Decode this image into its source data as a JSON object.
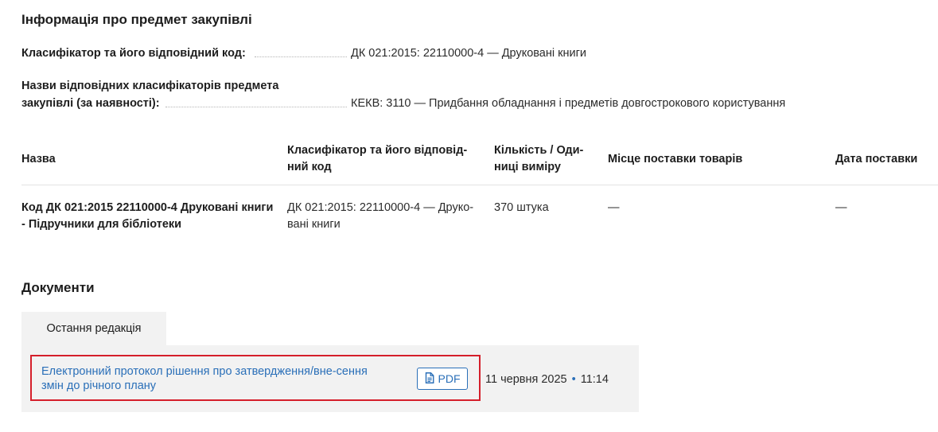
{
  "info": {
    "title": "Інформація про предмет закупівлі",
    "classifier_label": "Класифікатор та його відповідний код:",
    "classifier_value": "ДК 021:2015: 22110000-4 — Друковані книги",
    "related_label_line1": "Назви відповідних класифікаторів предмета",
    "related_label_line2": "закупівлі (за наявності):",
    "related_value": "КЕКВ: 3110 — Придбання обладнання і предметів довгострокового користування"
  },
  "items_table": {
    "headers": {
      "name": "Назва",
      "classifier": "Класифікатор та його відповід-ний код",
      "quantity": "Кількість / Оди-ниці виміру",
      "place": "Місце поставки товарів",
      "date": "Дата поставки"
    },
    "rows": [
      {
        "name": "Код ДК 021:2015 22110000-4 Друковані книги - Підручники для бібліотеки",
        "classifier": "ДК 021:2015: 22110000-4 — Друко-вані книги",
        "quantity": "370 штука",
        "place": "—",
        "date": "—"
      }
    ]
  },
  "documents": {
    "title": "Документи",
    "tab_label": "Остання редакція",
    "items": [
      {
        "title": "Електронний протокол рішення про затвердження/вне-сення змін до річного плану",
        "format": "PDF",
        "date": "11 червня 2025",
        "separator": "•",
        "time": "11:14"
      }
    ]
  },
  "colors": {
    "link": "#2a6fb8",
    "highlight_border": "#d51f2b",
    "panel_bg": "#f2f2f2"
  },
  "icons": {
    "pdf": "document-icon"
  }
}
